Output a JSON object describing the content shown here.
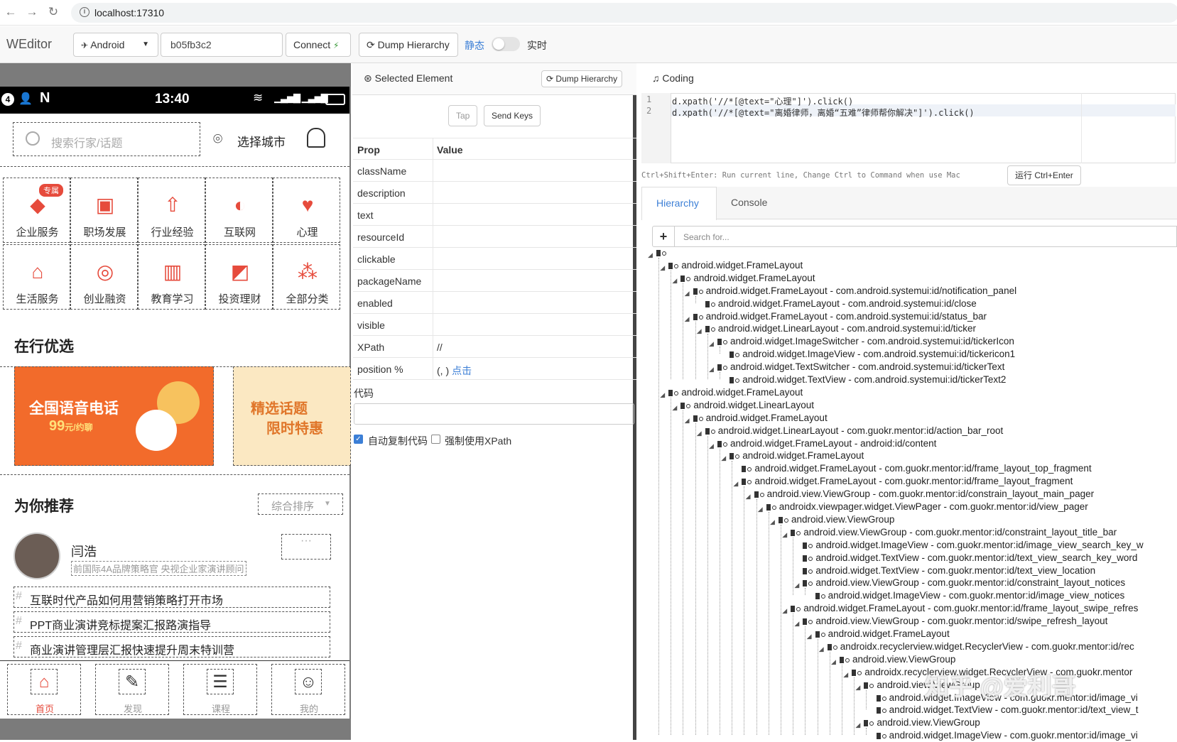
{
  "browser": {
    "url": "localhost:17310"
  },
  "toolbar": {
    "brand": "WEditor",
    "platform": "Android",
    "device_id": "b05fb3c2",
    "connect": "Connect",
    "dump_hierarchy": "Dump Hierarchy",
    "mode_static": "静态",
    "mode_realtime": "实时"
  },
  "phone": {
    "status_time": "13:40",
    "search_placeholder": "搜索行家/话题",
    "city": "选择城市",
    "badge": "专属",
    "grid": [
      "企业服务",
      "职场发展",
      "行业经验",
      "互联网",
      "心理",
      "生活服务",
      "创业融资",
      "教育学习",
      "投资理财",
      "全部分类"
    ],
    "section1": "在行优选",
    "banner1_title": "全国语音电话",
    "banner1_price": "99",
    "banner1_unit": "元/约聊",
    "banner2_line1": "精选话题",
    "banner2_line2": "限时特惠",
    "section2": "为你推荐",
    "sort": "综合排序",
    "person_name": "闫浩",
    "person_desc": "前国际4A品牌策略官 央视企业家演讲顾问",
    "topics": [
      "互联时代产品如何用营销策略打开市场",
      "PPT商业演讲竞标提案汇报路演指导",
      "商业演讲管理层汇报快速提升周末特训营"
    ],
    "nav": [
      "首页",
      "发现",
      "课程",
      "我的"
    ]
  },
  "selected": {
    "title": "Selected Element",
    "dump_hierarchy": "Dump Hierarchy",
    "tap": "Tap",
    "send_keys": "Send Keys",
    "col_prop": "Prop",
    "col_value": "Value",
    "props": [
      "className",
      "description",
      "text",
      "resourceId",
      "clickable",
      "packageName",
      "enabled",
      "visible",
      "XPath",
      "position %"
    ],
    "xpath_value": "//",
    "position_value": "(, )",
    "click_link": "点击",
    "code_label": "代码",
    "auto_copy": "自动复制代码",
    "force_xpath": "强制使用XPath"
  },
  "coding": {
    "title": "Coding",
    "lines": [
      "d.xpath('//*[@text=\"心理\"]').click()",
      "d.xpath('//*[@text=\"离婚律师，离婚“五难”律师帮你解决\"]').click()"
    ],
    "hint": "Ctrl+Shift+Enter: Run current line, Change Ctrl to Command when use Mac",
    "run_button": "运行 Ctrl+Enter"
  },
  "tabs": {
    "hierarchy": "Hierarchy",
    "console": "Console"
  },
  "tree": {
    "search_placeholder": "Search for...",
    "nodes": [
      {
        "d": 0,
        "t": ""
      },
      {
        "d": 1,
        "t": "android.widget.FrameLayout"
      },
      {
        "d": 2,
        "t": "android.widget.FrameLayout"
      },
      {
        "d": 3,
        "t": "android.widget.FrameLayout - com.android.systemui:id/notification_panel"
      },
      {
        "d": 4,
        "t": "android.widget.FrameLayout - com.android.systemui:id/close"
      },
      {
        "d": 3,
        "t": "android.widget.FrameLayout - com.android.systemui:id/status_bar"
      },
      {
        "d": 4,
        "t": "android.widget.LinearLayout - com.android.systemui:id/ticker"
      },
      {
        "d": 5,
        "t": "android.widget.ImageSwitcher - com.android.systemui:id/tickerIcon"
      },
      {
        "d": 6,
        "t": "android.widget.ImageView - com.android.systemui:id/tickericon1"
      },
      {
        "d": 5,
        "t": "android.widget.TextSwitcher - com.android.systemui:id/tickerText"
      },
      {
        "d": 6,
        "t": "android.widget.TextView - com.android.systemui:id/tickerText2"
      },
      {
        "d": 1,
        "t": "android.widget.FrameLayout"
      },
      {
        "d": 2,
        "t": "android.widget.LinearLayout"
      },
      {
        "d": 3,
        "t": "android.widget.FrameLayout"
      },
      {
        "d": 4,
        "t": "android.widget.LinearLayout - com.guokr.mentor:id/action_bar_root"
      },
      {
        "d": 5,
        "t": "android.widget.FrameLayout - android:id/content"
      },
      {
        "d": 6,
        "t": "android.widget.FrameLayout"
      },
      {
        "d": 7,
        "t": "android.widget.FrameLayout - com.guokr.mentor:id/frame_layout_top_fragment"
      },
      {
        "d": 7,
        "t": "android.widget.FrameLayout - com.guokr.mentor:id/frame_layout_fragment"
      },
      {
        "d": 8,
        "t": "android.view.ViewGroup - com.guokr.mentor:id/constrain_layout_main_pager"
      },
      {
        "d": 9,
        "t": "androidx.viewpager.widget.ViewPager - com.guokr.mentor:id/view_pager"
      },
      {
        "d": 10,
        "t": "android.view.ViewGroup"
      },
      {
        "d": 11,
        "t": "android.view.ViewGroup - com.guokr.mentor:id/constraint_layout_title_bar"
      },
      {
        "d": 12,
        "t": "android.widget.ImageView - com.guokr.mentor:id/image_view_search_key_w"
      },
      {
        "d": 12,
        "t": "android.widget.TextView - com.guokr.mentor:id/text_view_search_key_word"
      },
      {
        "d": 12,
        "t": "android.widget.TextView - com.guokr.mentor:id/text_view_location"
      },
      {
        "d": 12,
        "t": "android.view.ViewGroup - com.guokr.mentor:id/constraint_layout_notices"
      },
      {
        "d": 13,
        "t": "android.widget.ImageView - com.guokr.mentor:id/image_view_notices"
      },
      {
        "d": 11,
        "t": "android.widget.FrameLayout - com.guokr.mentor:id/frame_layout_swipe_refres"
      },
      {
        "d": 12,
        "t": "android.view.ViewGroup - com.guokr.mentor:id/swipe_refresh_layout"
      },
      {
        "d": 13,
        "t": "android.widget.FrameLayout"
      },
      {
        "d": 14,
        "t": "androidx.recyclerview.widget.RecyclerView - com.guokr.mentor:id/rec"
      },
      {
        "d": 15,
        "t": "android.view.ViewGroup"
      },
      {
        "d": 16,
        "t": "androidx.recyclerview.widget.RecyclerView - com.guokr.mentor"
      },
      {
        "d": 17,
        "t": "android.view.ViewGroup"
      },
      {
        "d": 18,
        "t": "android.widget.ImageView - com.guokr.mentor:id/image_vi"
      },
      {
        "d": 18,
        "t": "android.widget.TextView - com.guokr.mentor:id/text_view_t"
      },
      {
        "d": 17,
        "t": "android.view.ViewGroup"
      },
      {
        "d": 18,
        "t": "android.widget.ImageView - com.guokr.mentor:id/image_vi"
      }
    ]
  },
  "watermark": "知乎 @爱利哥",
  "colors": {
    "accent": "#3c7fd6",
    "orange": "#f26b2b",
    "bannerYellow": "#fbe8c2",
    "navActive": "#e64b3c"
  }
}
